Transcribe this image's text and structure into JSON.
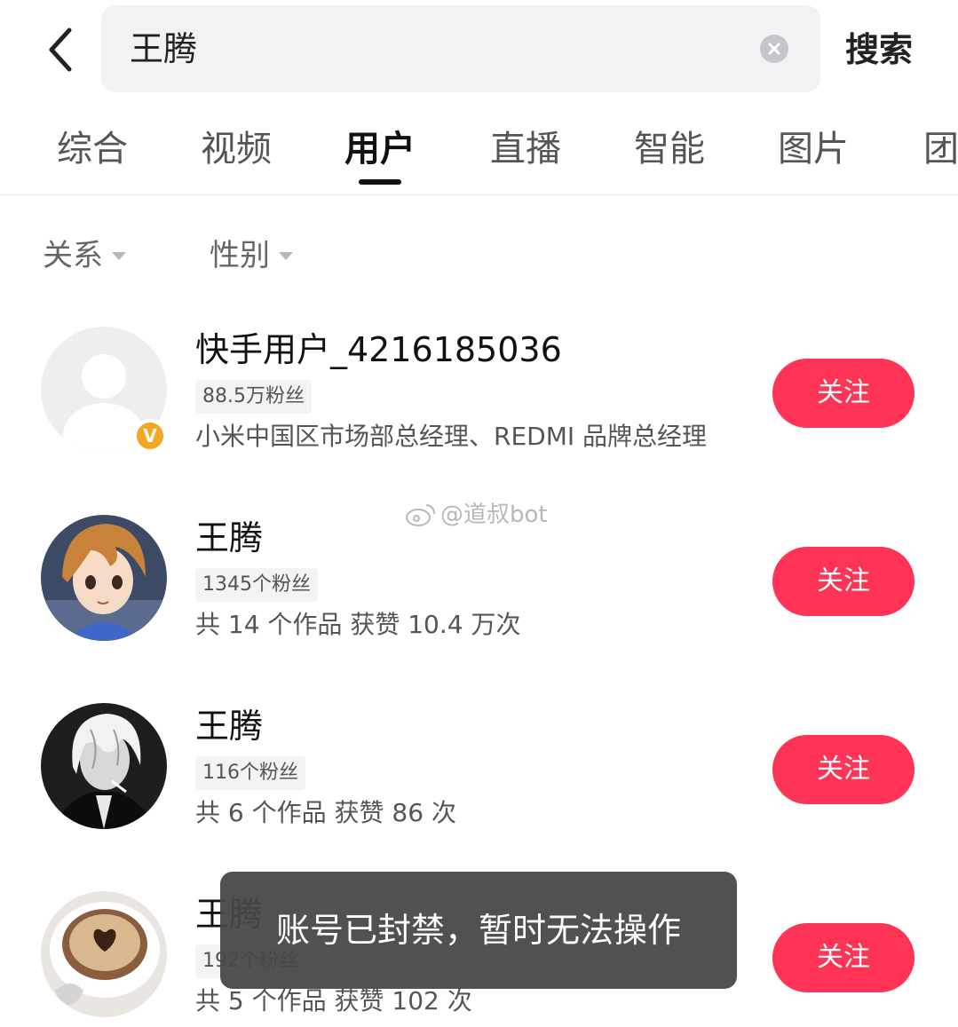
{
  "search": {
    "query": "王腾",
    "submit_label": "搜索"
  },
  "tabs": [
    {
      "label": "综合",
      "active": false
    },
    {
      "label": "视频",
      "active": false
    },
    {
      "label": "用户",
      "active": true
    },
    {
      "label": "直播",
      "active": false
    },
    {
      "label": "智能",
      "active": false
    },
    {
      "label": "图片",
      "active": false
    },
    {
      "label": "团",
      "active": false
    }
  ],
  "filters": {
    "relation_label": "关系",
    "gender_label": "性别"
  },
  "users": [
    {
      "name": "快手用户_4216185036",
      "fans": "88.5万粉丝",
      "desc": "小米中国区市场部总经理、REDMI 品牌总经理",
      "verified": true,
      "avatar_icon": "default-user-icon",
      "follow_label": "关注"
    },
    {
      "name": "王腾",
      "fans": "1345个粉丝",
      "desc": "共 14 个作品 获赞 10.4 万次",
      "verified": false,
      "avatar_icon": "anime-boy-avatar",
      "follow_label": "关注"
    },
    {
      "name": "王腾",
      "fans": "116个粉丝",
      "desc": "共 6 个作品 获赞 86 次",
      "verified": false,
      "avatar_icon": "monochrome-anime-avatar",
      "follow_label": "关注"
    },
    {
      "name": "王腾",
      "fans": "192个粉丝",
      "desc": "共 5 个作品 获赞 102 次",
      "verified": false,
      "avatar_icon": "coffee-cup-avatar",
      "follow_label": "关注"
    }
  ],
  "verified_badge": "V",
  "watermark": "@道叔bot",
  "toast": "账号已封禁，暂时无法操作",
  "colors": {
    "follow_button": "#fe3355",
    "verified_badge": "#f4a521",
    "search_background": "#f1f2f4",
    "toast_background": "#464646"
  }
}
